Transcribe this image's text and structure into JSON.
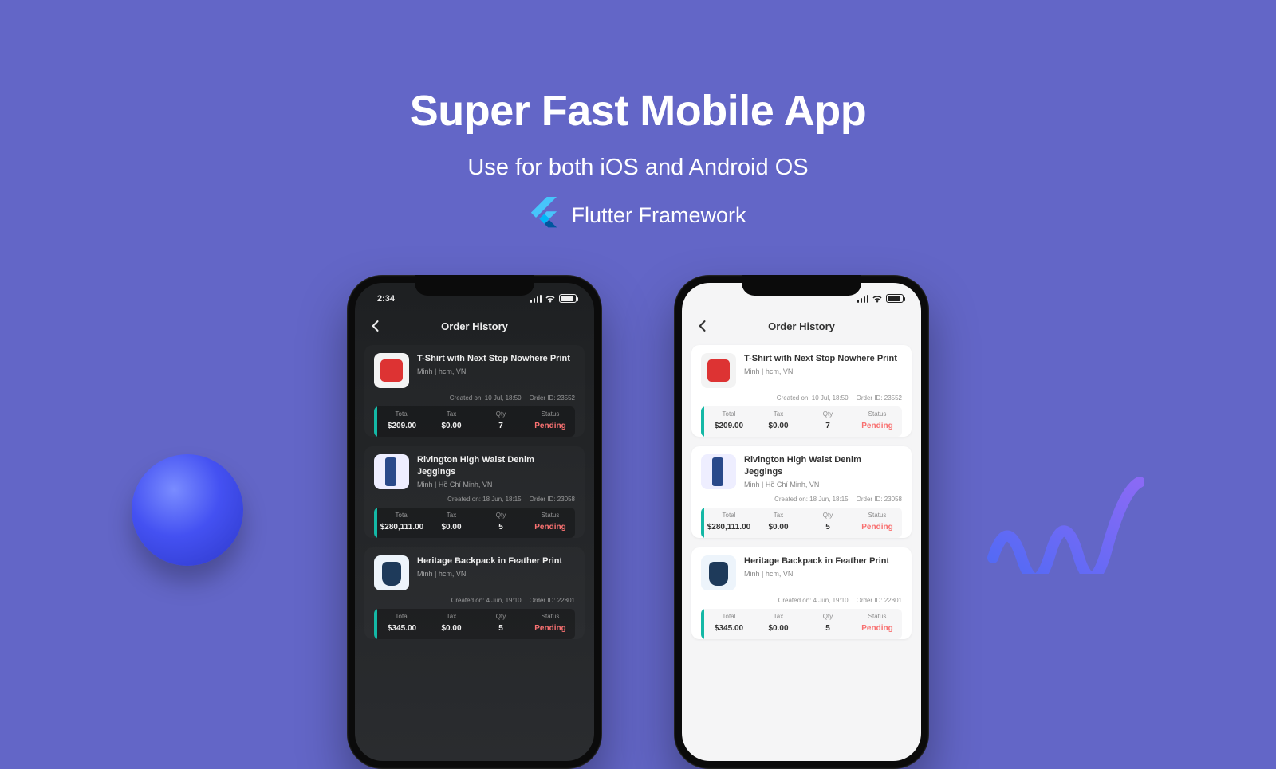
{
  "hero": {
    "title": "Super Fast Mobile App",
    "subtitle": "Use for both iOS and Android OS",
    "framework": "Flutter Framework"
  },
  "phone": {
    "status_time": "2:34",
    "nav_title": "Order History",
    "labels": {
      "total": "Total",
      "tax": "Tax",
      "qty": "Qty",
      "status": "Status",
      "created_prefix": "Created on:",
      "order_id_prefix": "Order ID:"
    }
  },
  "orders": [
    {
      "title": "T-Shirt with Next Stop Nowhere Print",
      "sub": "Minh | hcm, VN",
      "created": "10 Jul, 18:50",
      "order_id": "23552",
      "total": "$209.00",
      "tax": "$0.00",
      "qty": "7",
      "status": "Pending",
      "thumb": "tee"
    },
    {
      "title": "Rivington High Waist Denim Jeggings",
      "sub": "Minh | Hồ Chí Minh, VN",
      "created": "18 Jun, 18:15",
      "order_id": "23058",
      "total": "$280,111.00",
      "tax": "$0.00",
      "qty": "5",
      "status": "Pending",
      "thumb": "jeans"
    },
    {
      "title": "Heritage Backpack in Feather Print",
      "sub": "Minh | hcm, VN",
      "created": "4 Jun, 19:10",
      "order_id": "22801",
      "total": "$345.00",
      "tax": "$0.00",
      "qty": "5",
      "status": "Pending",
      "thumb": "bag"
    }
  ]
}
